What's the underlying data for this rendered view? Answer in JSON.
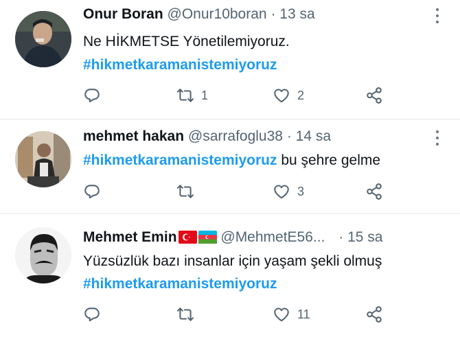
{
  "tweets": [
    {
      "name": "Onur Boran",
      "handle": "@Onur10boran",
      "time": "13 sa",
      "line1": "Ne HİKMETSE Yönetilemiyoruz.",
      "hashtag": "#hikmetkaramanistemiyoruz",
      "replies": "",
      "retweets": "1",
      "likes": "2"
    },
    {
      "name": "mehmet hakan",
      "handle": "@sarrafoglu38",
      "time": "14 sa",
      "hashtag": "#hikmetkaramanistemiyoruz",
      "text_after_hashtag": "bu şehre gelme",
      "replies": "",
      "retweets": "",
      "likes": "3"
    },
    {
      "name": "Mehmet Emin",
      "handle": "@MehmetE56...",
      "time": "15 sa",
      "line1": "Yüzsüzlük bazı insanlar için yaşam şekli olmuş",
      "hashtag": "#hikmetkaramanistemiyoruz",
      "replies": "",
      "retweets": "",
      "likes": "11",
      "flags": [
        "turkey-flag",
        "azerbaijan-flag"
      ]
    }
  ],
  "separator": "·",
  "colors": {
    "hashtag": "#1d9bf0",
    "secondary_text": "#536471",
    "icon": "#536471",
    "divider": "#e3e6e8"
  },
  "icons": [
    "reply-icon",
    "retweet-icon",
    "like-icon",
    "share-icon",
    "more-options-icon"
  ]
}
